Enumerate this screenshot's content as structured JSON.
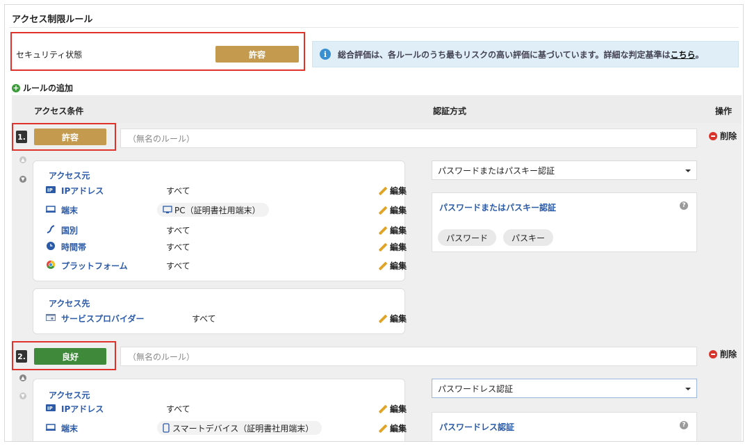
{
  "page": {
    "title": "アクセス制限ルール"
  },
  "security": {
    "label": "セキュリティ状態",
    "status": "許容"
  },
  "info": {
    "text": "総合評価は、各ルールのうち最もリスクの高い評価に基づいています。詳細な判定基準は",
    "link": "こちら",
    "suffix": "。"
  },
  "add_rule": {
    "label": "ルールの追加"
  },
  "columns": {
    "access_conditions": "アクセス条件",
    "auth_method": "認証方式",
    "operation": "操作"
  },
  "rules": [
    {
      "num": "1.",
      "status": "許容",
      "name_placeholder": "（無名のルール）",
      "delete_label": "削除",
      "access_source": {
        "title": "アクセス元",
        "rows": [
          {
            "label": "IPアドレス",
            "value": "すべて",
            "edit": "編集",
            "icon": "ip-icon"
          },
          {
            "label": "端末",
            "value": "PC（証明書社用端末）",
            "edit": "編集",
            "icon": "device-icon"
          },
          {
            "label": "国別",
            "value": "すべて",
            "edit": "編集",
            "icon": "country-icon"
          },
          {
            "label": "時間帯",
            "value": "すべて",
            "edit": "編集",
            "icon": "clock-icon"
          },
          {
            "label": "プラットフォーム",
            "value": "すべて",
            "edit": "編集",
            "icon": "platform-icon"
          }
        ]
      },
      "access_target": {
        "title": "アクセス先",
        "rows": [
          {
            "label": "サービスプロバイダー",
            "value": "すべて",
            "edit": "編集",
            "icon": "service-provider-icon"
          }
        ]
      },
      "auth": {
        "selected": "パスワードまたはパスキー認証",
        "panel_title": "パスワードまたはパスキー認証",
        "chips": [
          "パスワード",
          "パスキー"
        ]
      }
    },
    {
      "num": "2.",
      "status": "良好",
      "name_placeholder": "（無名のルール）",
      "delete_label": "削除",
      "access_source": {
        "title": "アクセス元",
        "rows": [
          {
            "label": "IPアドレス",
            "value": "すべて",
            "edit": "編集",
            "icon": "ip-icon"
          },
          {
            "label": "端末",
            "value": "スマートデバイス（証明書社用端末）",
            "edit": "編集",
            "icon": "device-icon"
          }
        ]
      },
      "auth": {
        "selected": "パスワードレス認証",
        "panel_title": "パスワードレス認証"
      }
    }
  ],
  "colors": {
    "permitted": "#c49a4e",
    "good": "#3f8a3a",
    "highlight": "#e0322b",
    "link_blue": "#2a5aa8"
  }
}
